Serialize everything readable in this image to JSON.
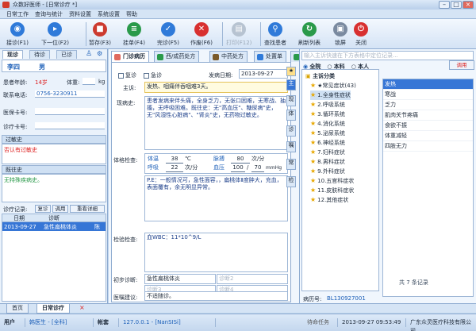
{
  "window": {
    "title": "众数好医师 - [日常诊疗 *]"
  },
  "menu": [
    "日常工作",
    "查询与统计",
    "资料设置",
    "系统设置",
    "帮助"
  ],
  "toolbar": [
    {
      "label": "接诊(F1)",
      "icon": "call-patient-icon",
      "color": "#2f7ad9"
    },
    {
      "label": "下一位(F2)",
      "icon": "next-icon",
      "color": "#2f7ad9"
    },
    {
      "label": "暂存(F3)",
      "icon": "save-icon",
      "color": "#cc3a2f"
    },
    {
      "label": "挂单(F4)",
      "icon": "pending-icon",
      "color": "#2a9a4a"
    },
    {
      "label": "完诊(F5)",
      "icon": "complete-icon",
      "color": "#2f7ad9"
    },
    {
      "label": "作废(F6)",
      "icon": "void-icon",
      "color": "#d83030"
    },
    {
      "label": "打印(F12)",
      "icon": "print-icon",
      "color": "#9aa7b6",
      "disabled": true
    },
    {
      "label": "查找患者",
      "icon": "find-patient-icon",
      "color": "#2f7ad9"
    },
    {
      "label": "刷新列表",
      "icon": "refresh-icon",
      "color": "#2a9a4a"
    },
    {
      "label": "锁屏",
      "icon": "lock-icon",
      "color": "#7a8aa0"
    },
    {
      "label": "关闭",
      "icon": "close-icon",
      "color": "#d83030"
    }
  ],
  "left": {
    "tabs": [
      "现诊",
      "待诊",
      "已诊"
    ],
    "patient_name": "李四",
    "gender": "男",
    "age_label": "患者年龄:",
    "age": "14岁",
    "weight_label": "体重:",
    "weight_unit": "kg",
    "phone_label": "联系电话:",
    "phone": "0756-3230911",
    "insurance_label": "医保卡号:",
    "clinic_label": "诊疗卡号:",
    "allergy_label": "过敏史",
    "allergy": "否认有过敏史",
    "history_label": "既往史",
    "history": "无特殊疾病史。",
    "record_label": "诊疗记录:",
    "record_btns": [
      "复诊",
      "调用",
      "重看详细"
    ],
    "record_cols": [
      "日期",
      "诊断",
      ""
    ],
    "records": [
      {
        "date": "2013-09-27",
        "diag": "急性扁桃体炎",
        "doctor": "陈"
      }
    ]
  },
  "main": {
    "tabs": [
      "门诊病历",
      "西/成药处方",
      "中药处方",
      "处置单",
      "其它"
    ],
    "revisit": "复诊",
    "emergency": "急诊",
    "onset_label": "发病日期:",
    "onset_date": "2013-09-27",
    "complaint_label": "主诉:",
    "complaint": "发热、咽痛伴吞咽难3天。",
    "present_label": "现病史:",
    "present": "患者发病来伴头痛，全身乏力，无张口困难，无寒战、抽搐，无呼吸困难。既往史：无\"高血压\"、糖尿病\"史，无\"风湿性心脏病\"、\"肾炎\"史，无药物过敏史。",
    "exam_label": "体格检查:",
    "temp_label": "体温",
    "temp": "38",
    "temp_unit": "℃",
    "pulse_label": "脉搏",
    "pulse": "80",
    "pulse_unit": "次/分",
    "resp_label": "呼吸",
    "resp": "22",
    "resp_unit": "次/分",
    "bp_label": "血压",
    "bp_high": "100",
    "bp_low": "70",
    "bp_unit": "mmHg",
    "exam_text": "P.E：一般情况可，急性面容，，扁桃体Ⅱ度肿大，充血，表面覆有，余无明显异常。",
    "lab_label": "检验检查:",
    "lab": "血WBC：11*10^9/L",
    "diag_label": "初步诊断:",
    "diag1": "急性扁桃体炎",
    "diag2_ph": "诊断2",
    "diag3_ph": "诊断3",
    "diag4_ph": "诊断4",
    "advice_label": "医嘱建议:",
    "advice": "不适随诊。",
    "side_tabs": [
      "主",
      "现",
      "体",
      "诊",
      "嘱",
      "常",
      "检"
    ]
  },
  "right": {
    "search_ph": "输入主诉快速在下方表格中定位记录...",
    "scope": [
      "全院",
      "本科",
      "本人"
    ],
    "use_btn": "调用",
    "tree_root": "主诉分类",
    "tree": [
      "★常见症状(43)",
      "1.全身性症状",
      "2.呼吸系统",
      "3.循环系统",
      "4.消化系统",
      "5.泌尿系统",
      "6.神经系统",
      "7.妇科症状",
      "8.男科症状",
      "9.外科症状",
      "10.五官科症状",
      "11.皮肤科症状",
      "12.其他症状"
    ],
    "list": [
      "发热",
      "寒战",
      "乏力",
      "肌肉关节疼痛",
      "食欲不振",
      "体重减轻",
      "四肢无力"
    ],
    "total": "共 7 条记录",
    "record_no_label": "病历号:",
    "record_no": "BL130927001"
  },
  "bottom_tabs": [
    "首页",
    "日常诊疗"
  ],
  "status": {
    "user_label": "用户",
    "user": "韩医生 - [全科]",
    "account_label": "帐套",
    "ip": "127.0.0.1 - [NanSISi]",
    "ready": "待命任务",
    "datetime": "2013-09-27 09:53:49",
    "company": "广东众灵医疗科技有限公司"
  }
}
